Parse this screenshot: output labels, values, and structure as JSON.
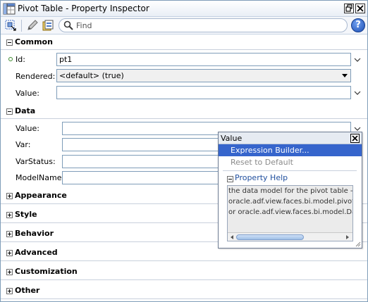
{
  "window": {
    "title": "Pivot Table - Property Inspector"
  },
  "toolbar": {
    "find_placeholder": "Find",
    "help_label": "?"
  },
  "sections": {
    "common": "Common",
    "data": "Data",
    "collapsed": [
      "Appearance",
      "Style",
      "Behavior",
      "Advanced",
      "Customization",
      "Other"
    ]
  },
  "common": {
    "id_label": "Id:",
    "id_value": "pt1",
    "rendered_label": "Rendered:",
    "rendered_value": "<default> (true)",
    "value_label": "Value:",
    "value_value": ""
  },
  "data": {
    "value_label": "Value:",
    "var_label": "Var:",
    "varstatus_label": "VarStatus:",
    "modelname_label": "ModelName:"
  },
  "popup": {
    "title": "Value",
    "menu": [
      {
        "label": "Expression Builder...",
        "state": "selected"
      },
      {
        "label": "Reset to Default",
        "state": "disabled"
      }
    ],
    "property_help_title": "Property Help",
    "help_lines": [
      "the data model for the pivot table - ca",
      "oracle.adf.view.faces.bi.model.pivotT",
      " or oracle.adf.view.faces.bi.model.Da"
    ]
  },
  "colors": {
    "accent": "#3665cc",
    "border": "#7f9db9",
    "required_dot": "#3c8a2c"
  }
}
